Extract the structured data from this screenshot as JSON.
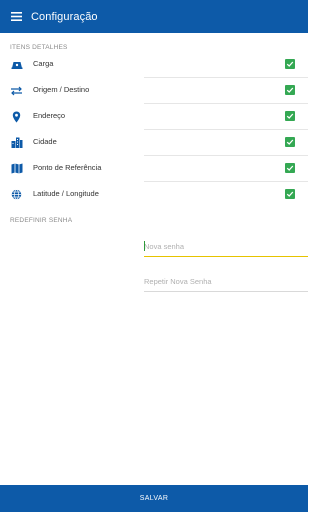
{
  "app_bar": {
    "title": "Configuração"
  },
  "details": {
    "section_title": "ITENS DETALHES",
    "items": [
      {
        "label": "Carga",
        "icon": "truck-icon",
        "checked": true
      },
      {
        "label": "Origem / Destino",
        "icon": "swap-arrows-icon",
        "checked": true
      },
      {
        "label": "Endereço",
        "icon": "map-pin-icon",
        "checked": true
      },
      {
        "label": "Cidade",
        "icon": "city-icon",
        "checked": true
      },
      {
        "label": "Ponto de Referência",
        "icon": "map-icon",
        "checked": true
      },
      {
        "label": "Latitude / Longitude",
        "icon": "globe-icon",
        "checked": true
      }
    ]
  },
  "password": {
    "section_title": "REDEFINIR SENHA",
    "new_password_placeholder": "Nova senha",
    "repeat_password_placeholder": "Repetir Nova Senha"
  },
  "footer": {
    "save_label": "SALVAR"
  },
  "colors": {
    "primary": "#0d5aa8",
    "check": "#34a853",
    "active_underline": "#e6c300"
  }
}
